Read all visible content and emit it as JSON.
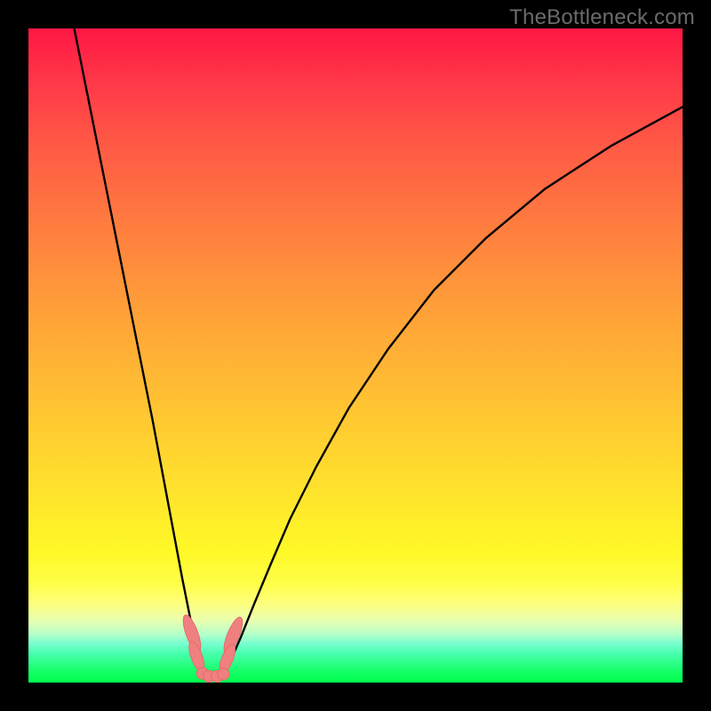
{
  "watermark": "TheBottleneck.com",
  "chart_data": {
    "type": "line",
    "title": "",
    "xlabel": "",
    "ylabel": "",
    "xlim": [
      0,
      100
    ],
    "ylim": [
      0,
      100
    ],
    "grid": false,
    "legend": false,
    "background": "rainbow-gradient",
    "series": [
      {
        "name": "left-branch",
        "x": [
          7,
          9,
          11,
          13,
          15,
          17,
          19,
          20.5,
          22,
          23.5,
          24.7,
          25.6,
          26.3,
          26.8,
          27.1
        ],
        "y": [
          100,
          90,
          80,
          70,
          60,
          50,
          40,
          32,
          24,
          16,
          10,
          6,
          3.4,
          1.7,
          0.8
        ]
      },
      {
        "name": "right-branch",
        "x": [
          29.5,
          30,
          31,
          32.5,
          34.5,
          37,
          40,
          44,
          49,
          55,
          62,
          70,
          79,
          89,
          100
        ],
        "y": [
          0.8,
          1.6,
          3.6,
          7,
          12,
          18,
          25,
          33,
          42,
          51,
          60,
          68,
          75.5,
          82,
          88
        ]
      }
    ],
    "trough": {
      "x_range": [
        27.1,
        29.5
      ],
      "y": 0.8
    },
    "markers": [
      {
        "shape": "pill",
        "cx": 25.0,
        "cy": 7.5,
        "rx": 0.9,
        "ry": 3.0,
        "angle": -20
      },
      {
        "shape": "pill",
        "cx": 25.7,
        "cy": 4.0,
        "rx": 0.85,
        "ry": 2.4,
        "angle": -20
      },
      {
        "shape": "pill",
        "cx": 31.3,
        "cy": 7.2,
        "rx": 0.9,
        "ry": 3.0,
        "angle": 22
      },
      {
        "shape": "pill",
        "cx": 30.4,
        "cy": 3.6,
        "rx": 0.85,
        "ry": 2.4,
        "angle": 22
      },
      {
        "shape": "dot",
        "cx": 26.6,
        "cy": 1.4,
        "r": 0.9
      },
      {
        "shape": "dot",
        "cx": 27.6,
        "cy": 0.95,
        "r": 0.9
      },
      {
        "shape": "dot",
        "cx": 28.8,
        "cy": 0.95,
        "r": 0.9
      },
      {
        "shape": "dot",
        "cx": 29.8,
        "cy": 1.3,
        "r": 0.9
      }
    ],
    "colors": {
      "curve": "#000000",
      "marker_fill": "#f08080",
      "marker_stroke": "#e86a6a"
    }
  }
}
